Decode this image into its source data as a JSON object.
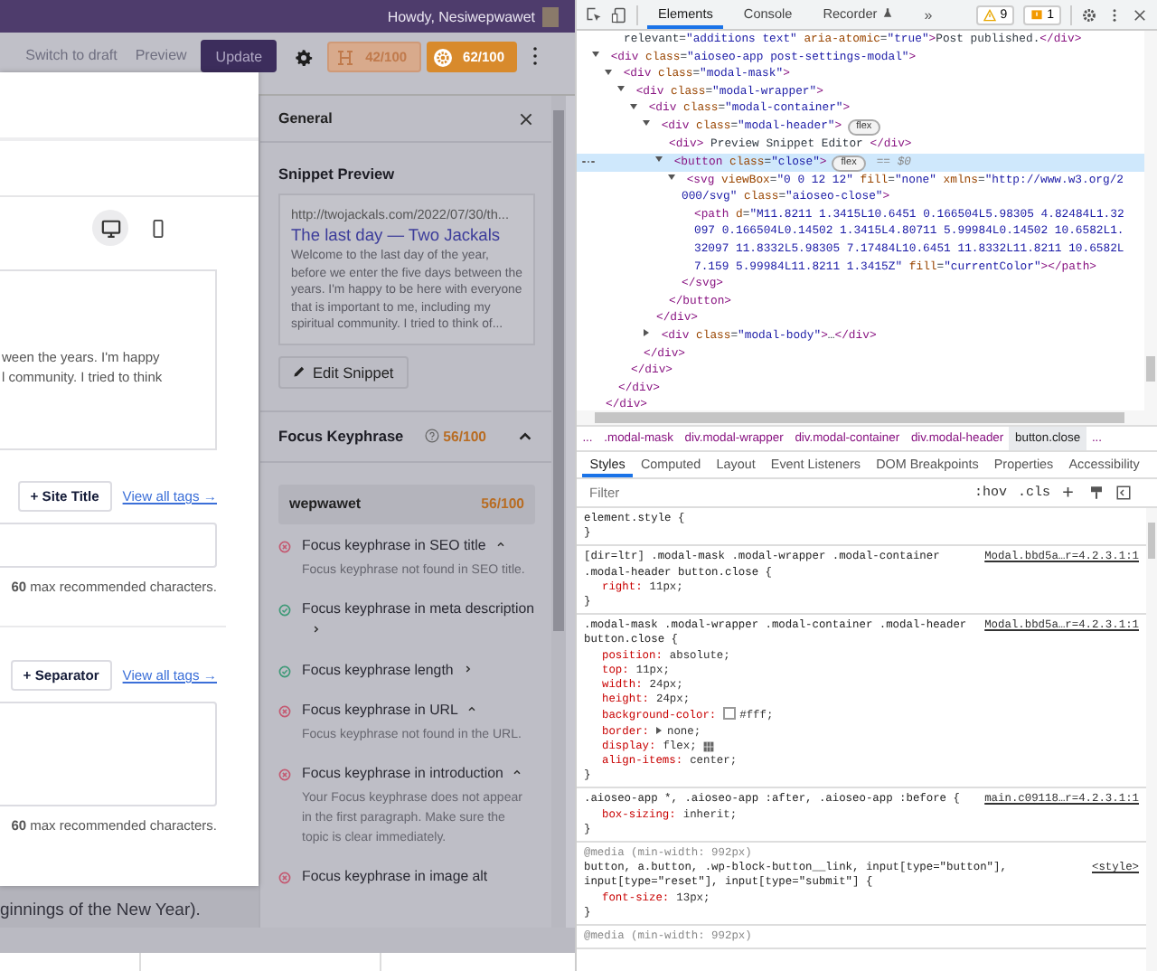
{
  "admin_bar": {
    "greeting": "Howdy, Nesiwepwawet"
  },
  "editor_header": {
    "actions": [
      {
        "label": "Switch to draft",
        "kind": "link"
      },
      {
        "label": "Preview",
        "kind": "link"
      },
      {
        "label": "Update",
        "kind": "primary"
      }
    ],
    "scores": [
      {
        "kind": "headline",
        "value": "42/100"
      },
      {
        "kind": "seo",
        "value": "62/100"
      }
    ]
  },
  "modal": {
    "device_toggle": [
      {
        "kind": "desktop",
        "selected": true
      },
      {
        "kind": "mobile",
        "selected": false
      }
    ],
    "preview_lines": [
      "ween the years. I'm happy",
      "l community. I tried to think"
    ],
    "sections": [
      {
        "tag_button": "+ Site Title",
        "link": "View all tags →",
        "kind": "input",
        "note": "**60** max recommended characters."
      },
      {
        "tag_button": "+ Separator",
        "link": "View all tags →",
        "kind": "textarea",
        "note": "**60** max recommended characters."
      }
    ]
  },
  "background_text": "ginnings of the New Year).",
  "sidebar": {
    "title": "General",
    "snippet_heading": "Snippet Preview",
    "snippet": {
      "url": "http://twojackals.com/2022/07/30/th...",
      "title": "The last day — Two Jackals",
      "description": "Welcome to the last day of the year, before we enter the five days between the years. I'm happy to be here with everyone that is important to me, including my spiritual community. I tried to think of..."
    },
    "edit_button": "Edit Snippet",
    "focus": {
      "heading": "Focus Keyphrase",
      "score": "56/100",
      "expanded": true,
      "keyphrase": "wepwawet",
      "keyphrase_score": "56/100",
      "checks": [
        {
          "kind": "fail",
          "title": "Focus keyphrase in SEO title",
          "expanded": true,
          "detail": "Focus keyphrase not found in SEO title."
        },
        {
          "kind": "pass",
          "title": "Focus keyphrase in meta description",
          "expanded": false
        },
        {
          "kind": "pass",
          "title": "Focus keyphrase length",
          "expanded": false
        },
        {
          "kind": "fail",
          "title": "Focus keyphrase in URL",
          "expanded": true,
          "detail": "Focus keyphrase not found in the URL."
        },
        {
          "kind": "fail",
          "title": "Focus keyphrase in introduction",
          "expanded": true,
          "detail": "Your Focus keyphrase does not appear in the first paragraph. Make sure the topic is clear immediately."
        },
        {
          "kind": "fail",
          "title": "Focus keyphrase in image alt"
        }
      ]
    }
  },
  "devtools": {
    "tabs": [
      {
        "label": "Elements",
        "selected": true
      },
      {
        "label": "Console",
        "selected": false
      },
      {
        "label": "Recorder",
        "selected": false
      }
    ],
    "more": "»",
    "warnings": "9",
    "issues": "1",
    "dom": {
      "top_line": "relevant=\"additions text\" aria-atomic=\"true\">Post published.</div>",
      "nodes": [
        {
          "text": "<div class=\"aioseo-app post-settings-modal\">",
          "expanded": true,
          "selected": false,
          "close": "</div>",
          "children": [
            {
              "text": "<div class=\"modal-mask\">",
              "expanded": true,
              "selected": false,
              "close": "</div>",
              "children": [
                {
                  "text": "<div class=\"modal-wrapper\">",
                  "expanded": true,
                  "selected": false,
                  "close": "</div>",
                  "children": [
                    {
                      "text": "<div class=\"modal-container\">",
                      "expanded": true,
                      "selected": false,
                      "close": "</div>",
                      "children": [
                        {
                          "text": "<div class=\"modal-header\">",
                          "badge": "flex",
                          "expanded": true,
                          "selected": false,
                          "close": "</div>",
                          "children": [
                            {
                              "text": "<div> Preview Snippet Editor </div>",
                              "selected": false
                            },
                            {
                              "text": "<button class=\"close\">",
                              "badge": "flex",
                              "suffix": "== $0",
                              "expanded": true,
                              "selected": true,
                              "close": "</button>",
                              "children": [
                                {
                                  "text": "<svg viewBox=\"0 0 12 12\" fill=\"none\" xmlns=\"http://www.w3.org/2000/svg\" class=\"aioseo-close\">",
                                  "expanded": true,
                                  "selected": false,
                                  "close": "</svg>",
                                  "children": [
                                    {
                                      "text": "<path d=\"M11.8211 1.3415L10.6451 0.166504L5.98305 4.82484L1.32097 0.166504L0.14502 1.3415L4.80711 5.99984L0.14502 10.6582L1.32097 11.8332L5.98305 7.17484L10.6451 11.8332L11.8211 10.6582L7.159 5.99984L11.8211 1.3415Z\" fill=\"currentColor\"></path>",
                                      "selected": false
                                    }
                                  ]
                                }
                              ]
                            }
                          ]
                        },
                        {
                          "text": "<div class=\"modal-body\">…</div>",
                          "expanded": false,
                          "selected": false
                        }
                      ]
                    }
                  ]
                }
              ]
            }
          ]
        }
      ]
    },
    "breadcrumb": [
      {
        "label": "...",
        "selected": false
      },
      {
        "label": ".modal-mask",
        "selected": false
      },
      {
        "label": "div.modal-wrapper",
        "selected": false
      },
      {
        "label": "div.modal-container",
        "selected": false
      },
      {
        "label": "div.modal-header",
        "selected": false
      },
      {
        "label": "button.close",
        "selected": true
      },
      {
        "label": "...",
        "selected": false
      }
    ],
    "pane_tabs": [
      {
        "label": "Styles",
        "selected": true
      },
      {
        "label": "Computed",
        "selected": false
      },
      {
        "label": "Layout",
        "selected": false
      },
      {
        "label": "Event Listeners",
        "selected": false
      },
      {
        "label": "DOM Breakpoints",
        "selected": false
      },
      {
        "label": "Properties",
        "selected": false
      },
      {
        "label": "Accessibility",
        "selected": false
      }
    ],
    "filter": {
      "placeholder": "Filter"
    },
    "filter_tools": [
      ":hov",
      ".cls"
    ],
    "rules": [
      {
        "selector": "element.style {",
        "close": "}"
      },
      {
        "selector": "[dir=ltr] .modal-mask .modal-wrapper .modal-container .modal-header button.close {",
        "source": "Modal.bbd5a…r=4.2.3.1:1",
        "declarations": [
          {
            "text": "right: 11px;",
            "kind": "plain"
          }
        ],
        "close": "}"
      },
      {
        "selector": ".modal-mask .modal-wrapper .modal-container .modal-header button.close {",
        "source": "Modal.bbd5a…r=4.2.3.1:1",
        "declarations": [
          {
            "text": "position: absolute;",
            "kind": "plain"
          },
          {
            "text": "top: 11px;",
            "kind": "plain"
          },
          {
            "text": "width: 24px;",
            "kind": "plain"
          },
          {
            "text": "height: 24px;",
            "kind": "plain"
          },
          {
            "text": "background-color: #fff;",
            "kind": "color"
          },
          {
            "text": "border: none;",
            "kind": "shorthand"
          },
          {
            "text": "display: flex;",
            "kind": "flex"
          },
          {
            "text": "align-items: center;",
            "kind": "plain"
          }
        ],
        "close": "}"
      },
      {
        "selector": ".aioseo-app *, .aioseo-app :after, .aioseo-app :before {",
        "source": "main.c09118…r=4.2.3.1:1",
        "declarations": [
          {
            "text": "box-sizing: inherit;",
            "kind": "plain"
          }
        ],
        "close": "}"
      },
      {
        "media": "@media (min-width: 992px)",
        "selector": "button, a.button, .wp-block-button__link, input[type=\"button\"], input[type=\"reset\"], input[type=\"submit\"] {",
        "source": "<style>",
        "declarations": [
          {
            "text": "font-size: 13px;",
            "kind": "plain"
          }
        ],
        "close": "}"
      },
      {
        "media": "@media (min-width: 992px)"
      }
    ]
  }
}
